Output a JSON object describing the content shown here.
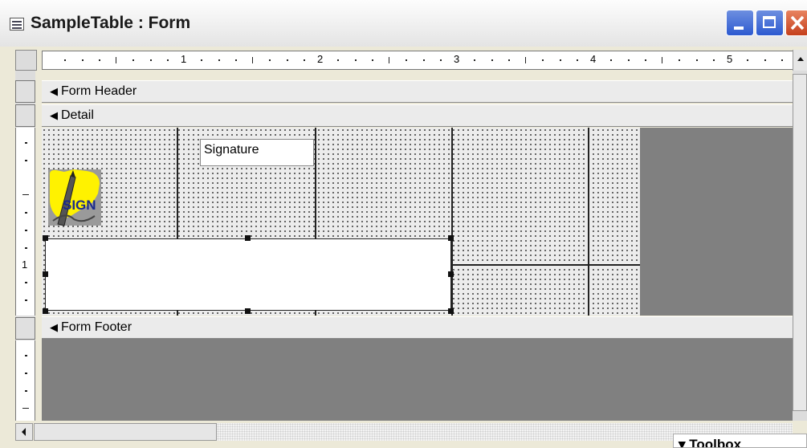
{
  "window": {
    "title": "SampleTable : Form"
  },
  "ruler": {
    "numbers": [
      "1",
      "2",
      "3",
      "4",
      "5"
    ]
  },
  "vertical_ruler": {
    "numbers": [
      "1"
    ]
  },
  "sections": {
    "header": "Form Header",
    "detail": "Detail",
    "footer": "Form Footer"
  },
  "detail": {
    "signature_label": "Signature",
    "sign_image_text": "SIGN"
  },
  "toolbox": {
    "title": "▾ Toolbox"
  },
  "colors": {
    "title_bar": "#f2f2f2",
    "xp_blue": "#2d5ad0",
    "xp_close": "#c5401d",
    "design_grid": "#ececec",
    "empty_area": "#808080",
    "sign_icon_yellow": "#fff200"
  },
  "icons": {
    "app": "form-icon",
    "section_marker": "section-marker-icon",
    "image": "signature-pen-icon"
  }
}
